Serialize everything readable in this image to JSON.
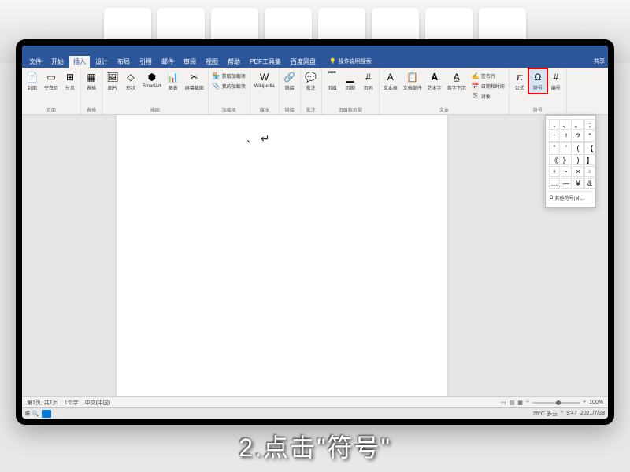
{
  "menu": {
    "tabs": [
      "文件",
      "开始",
      "插入",
      "设计",
      "布局",
      "引用",
      "邮件",
      "审阅",
      "视图",
      "帮助",
      "PDF工具集",
      "百度网盘"
    ],
    "active_index": 2,
    "tell_me": "操作说明搜索",
    "share": "共享"
  },
  "ribbon": {
    "groups": [
      {
        "label": "页面",
        "items": [
          {
            "icon": "📄",
            "label": "封面"
          },
          {
            "icon": "▭",
            "label": "空白页"
          },
          {
            "icon": "⊞",
            "label": "分页"
          }
        ]
      },
      {
        "label": "表格",
        "items": [
          {
            "icon": "▦",
            "label": "表格"
          }
        ]
      },
      {
        "label": "插图",
        "items": [
          {
            "icon": "🖼",
            "label": "图片"
          },
          {
            "icon": "◇",
            "label": "形状"
          },
          {
            "icon": "⬢",
            "label": "SmartArt"
          },
          {
            "icon": "📊",
            "label": "图表"
          },
          {
            "icon": "✂",
            "label": "屏幕截图"
          }
        ]
      },
      {
        "label": "加载项",
        "small_items": [
          {
            "icon": "🏪",
            "label": "获取加载项"
          },
          {
            "icon": "📎",
            "label": "我的加载项"
          }
        ]
      },
      {
        "label": "媒体",
        "items": [
          {
            "icon": "W",
            "label": "Wikipedia"
          }
        ]
      },
      {
        "label": "链接",
        "items": [
          {
            "icon": "🔗",
            "label": "链接"
          }
        ]
      },
      {
        "label": "批注",
        "items": [
          {
            "icon": "💬",
            "label": "批注"
          }
        ]
      },
      {
        "label": "页眉和页脚",
        "items": [
          {
            "icon": "▔",
            "label": "页眉"
          },
          {
            "icon": "▁",
            "label": "页脚"
          },
          {
            "icon": "#",
            "label": "页码"
          }
        ]
      },
      {
        "label": "文本",
        "items": [
          {
            "icon": "A",
            "label": "文本框"
          },
          {
            "icon": "📋",
            "label": "文档部件"
          },
          {
            "icon": "𝐀",
            "label": "艺术字"
          },
          {
            "icon": "A̲",
            "label": "首字下沉"
          }
        ],
        "small_items": [
          {
            "icon": "✍",
            "label": "签名行"
          },
          {
            "icon": "📅",
            "label": "日期和时间"
          },
          {
            "icon": "⎘",
            "label": "对象"
          }
        ]
      },
      {
        "label": "符号",
        "items": [
          {
            "icon": "π",
            "label": "公式"
          },
          {
            "icon": "Ω",
            "label": "符号",
            "highlighted": true
          },
          {
            "icon": "#",
            "label": "编号"
          }
        ]
      }
    ]
  },
  "symbol_panel": {
    "symbols": [
      ",",
      "、",
      "。",
      ";",
      ":",
      "!",
      "?",
      "\"",
      "\"",
      "'",
      "(",
      "【",
      "《",
      "》",
      ")",
      "】",
      "+",
      "-",
      "×",
      "÷",
      "…",
      "—",
      "¥",
      "&"
    ],
    "more_label": "其他符号(M)..."
  },
  "document": {
    "cursor_content": "、 ↵"
  },
  "statusbar": {
    "page": "第1页, 共1页",
    "words": "1个字",
    "lang": "中文(中国)",
    "zoom": "100%"
  },
  "taskbar": {
    "weather": "26°C 多云",
    "time": "9:47",
    "date": "2021/7/28"
  },
  "caption": "2.点击\"符号\""
}
